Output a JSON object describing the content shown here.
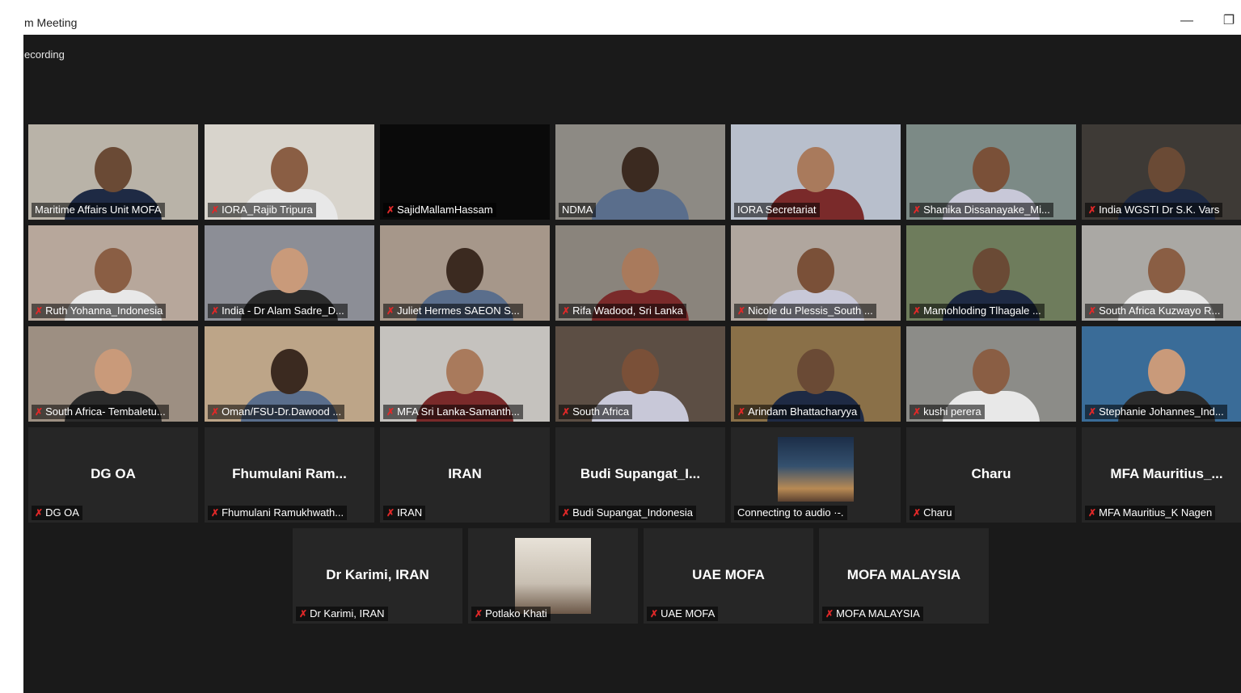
{
  "window": {
    "title": "m Meeting",
    "recording": "ecording",
    "minimize_icon": "minimize-icon",
    "restore_icon": "restore-icon"
  },
  "colors": {
    "active_speaker": "#b8e04a",
    "muted": "#e02828"
  },
  "video_tiles": [
    {
      "label": "Maritime Affairs Unit MOFA",
      "muted": false,
      "active": true
    },
    {
      "label": "IORA_Rajib Tripura",
      "muted": true
    },
    {
      "label": "SajidMallamHassam",
      "muted": true
    },
    {
      "label": "NDMA",
      "muted": false
    },
    {
      "label": "IORA Secretariat",
      "muted": false
    },
    {
      "label": "Shanika Dissanayake_Mi...",
      "muted": true
    },
    {
      "label": "India WGSTI Dr S.K. Vars",
      "muted": true
    },
    {
      "label": "Ruth Yohanna_Indonesia",
      "muted": true
    },
    {
      "label": "India - Dr Alam Sadre_D...",
      "muted": true
    },
    {
      "label": "Juliet Hermes SAEON S...",
      "muted": true
    },
    {
      "label": "Rifa Wadood, Sri Lanka",
      "muted": true
    },
    {
      "label": "Nicole du Plessis_South ...",
      "muted": true
    },
    {
      "label": "Mamohloding Tlhagale ...",
      "muted": true
    },
    {
      "label": "South Africa Kuzwayo R...",
      "muted": true
    },
    {
      "label": "South Africa- Tembaletu...",
      "muted": true
    },
    {
      "label": "Oman/FSU-Dr.Dawood ...",
      "muted": true
    },
    {
      "label": "MFA Sri Lanka-Samanth...",
      "muted": true
    },
    {
      "label": "South Africa",
      "muted": true
    },
    {
      "label": "Arindam Bhattacharyya",
      "muted": true
    },
    {
      "label": "kushi perera",
      "muted": true
    },
    {
      "label": "Stephanie Johannes_Ind...",
      "muted": true
    }
  ],
  "name_tiles": [
    {
      "name": "DG OA",
      "label": "DG OA"
    },
    {
      "name": "Fhumulani  Ram...",
      "label": "Fhumulani Ramukhwath..."
    },
    {
      "name": "IRAN",
      "label": "IRAN"
    },
    {
      "name": "Budi  Supangat_I...",
      "label": "Budi Supangat_Indonesia"
    },
    {
      "name": "",
      "label": "Connecting to audio ·-."
    },
    {
      "name": "Charu",
      "label": "Charu"
    },
    {
      "name": "MFA  Mauritius_...",
      "label": "MFA Mauritius_K Nagen"
    }
  ],
  "bottom_tiles": [
    {
      "name": "Dr Karimi, IRAN",
      "label": "Dr Karimi, IRAN"
    },
    {
      "name": "",
      "label": "Potlako Khati"
    },
    {
      "name": "UAE MOFA",
      "label": "UAE MOFA"
    },
    {
      "name": "MOFA MALAYSIA",
      "label": "MOFA MALAYSIA"
    }
  ]
}
